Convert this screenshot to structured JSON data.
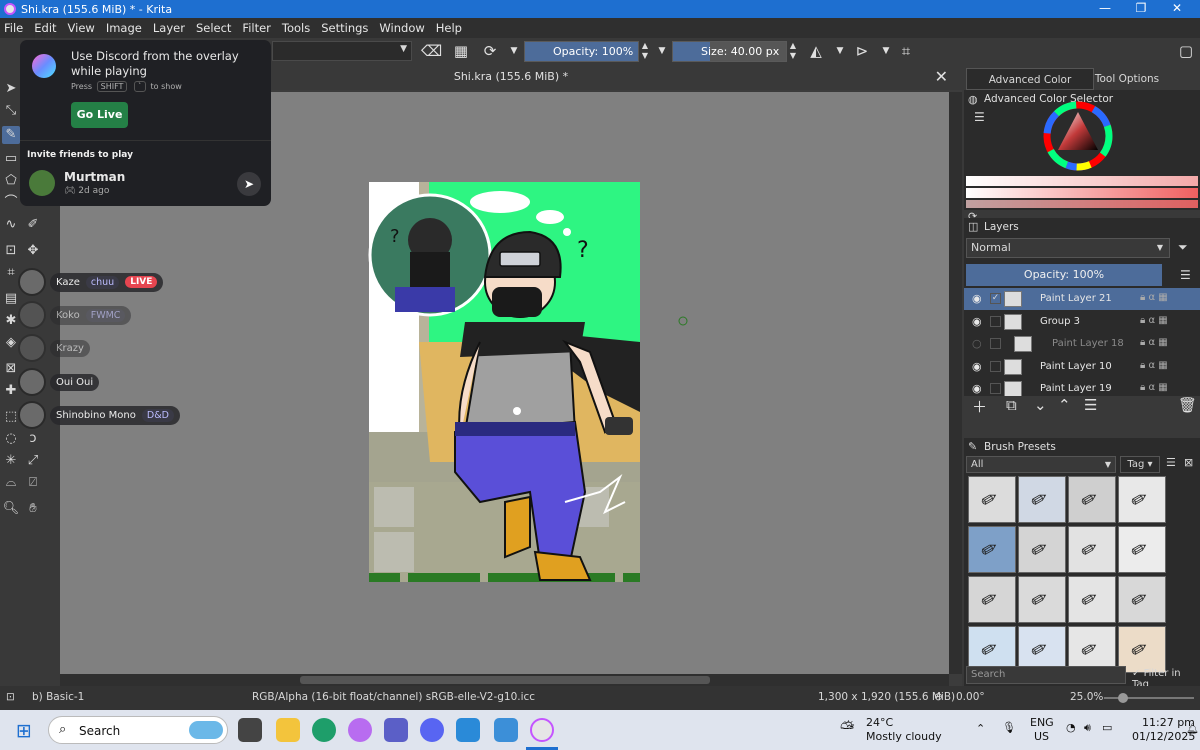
{
  "window": {
    "title": "Shi.kra (155.6 MiB) * - Krita"
  },
  "menubar": [
    "File",
    "Edit",
    "View",
    "Image",
    "Layer",
    "Select",
    "Filter",
    "Tools",
    "Settings",
    "Window",
    "Help"
  ],
  "toolbar": {
    "opacity": "Opacity: 100%",
    "size": "Size: 40.00 px"
  },
  "canvas": {
    "tab_title": "Shi.kra (155.6 MiB) *"
  },
  "discord_overlay": {
    "promo_title": "Use Discord from the overlay while playing",
    "hint_press": "Press",
    "hint_key": "SHIFT",
    "hint_key2": "`",
    "hint_suffix": "to show",
    "go_live": "Go Live",
    "invite_heading": "Invite friends to play",
    "friend_name": "Murtman",
    "friend_meta": "2d ago"
  },
  "presence": [
    {
      "name": "Kaze",
      "activity": "chuu",
      "live": "LIVE",
      "active": true
    },
    {
      "name": "Koko",
      "activity": "FWMC",
      "active": false
    },
    {
      "name": "Krazy",
      "active": false
    },
    {
      "name": "Oui Oui",
      "active": true
    },
    {
      "name": "Shinobino Mono",
      "activity": "D&D",
      "active": true
    }
  ],
  "dock": {
    "tabs": [
      "Advanced Color Selector",
      "Tool Options"
    ],
    "color_selector_title": "Advanced Color Selector",
    "layers_title": "Layers",
    "blend_mode": "Normal",
    "layer_opacity": "Opacity:  100%",
    "layers": [
      {
        "name": "Paint Layer 21",
        "selected": true,
        "visible": true
      },
      {
        "name": "Group 3",
        "selected": false,
        "visible": true
      },
      {
        "name": "Paint Layer 18",
        "selected": false,
        "visible": false
      },
      {
        "name": "Paint Layer 10",
        "selected": false,
        "visible": true
      },
      {
        "name": "Paint Layer 19",
        "selected": false,
        "visible": true
      }
    ],
    "brush_presets_title": "Brush Presets",
    "brush_filter": "All",
    "tag_label": "Tag",
    "search_placeholder": "Search",
    "filter_in_tag": "Filter in Tag"
  },
  "statusbar": {
    "brush": "b) Basic-1",
    "color_profile": "RGB/Alpha (16-bit float/channel)  sRGB-elle-V2-g10.icc",
    "dimensions": "1,300 x 1,920 (155.6 MiB)",
    "rotation": "0.00°",
    "zoom": "25.0%"
  },
  "taskbar": {
    "search_placeholder": "Search",
    "weather_temp": "24°C",
    "weather_desc": "Mostly cloudy",
    "lang": "ENG",
    "region": "US",
    "time": "11:27 pm",
    "date": "01/12/2025"
  },
  "colors": {
    "accent": "#1e6fd0",
    "discord_green": "#248046",
    "krita_blue": "#4d6c9a",
    "canvas_green": "#2ef582"
  }
}
